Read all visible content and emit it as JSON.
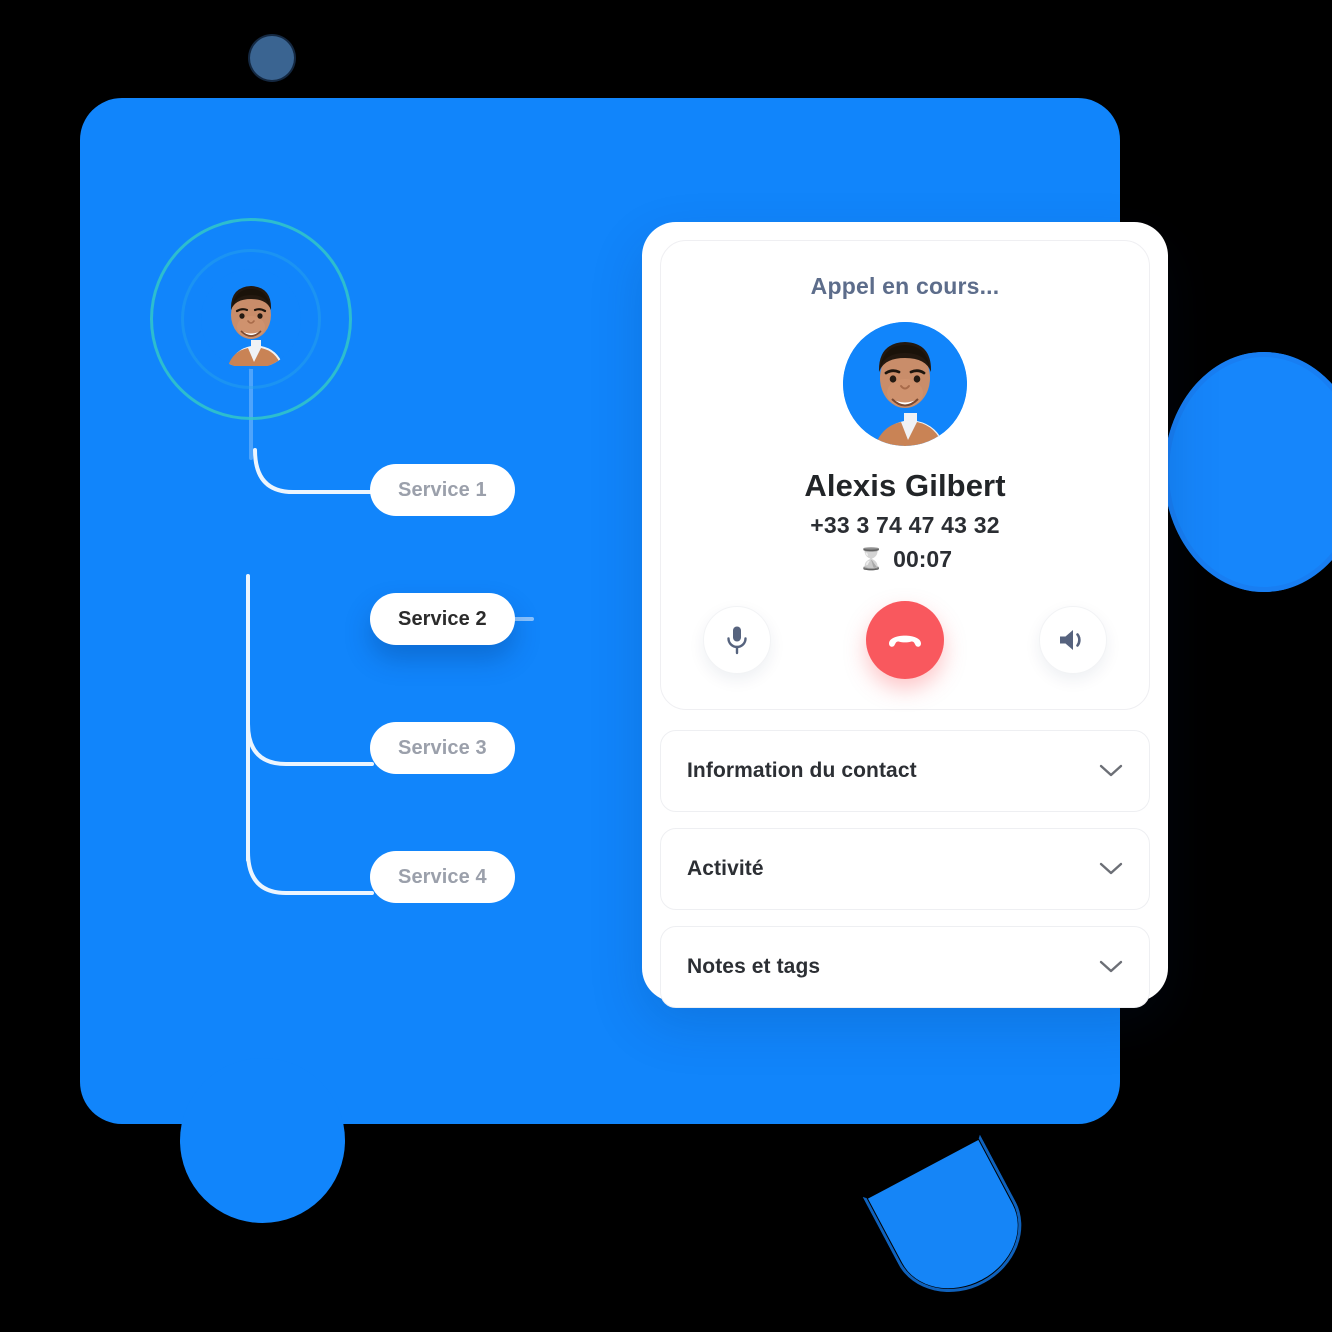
{
  "theme": {
    "brand_blue": "#1185FB",
    "panel_blue": "#1185FB",
    "pulse_ring_teal": "#33C9C4",
    "pulse_ring_blue": "#27A4E8",
    "hangup_red": "#F9585E",
    "pill_text_inactive": "#9BA0AB",
    "pill_text_active": "#2b2b2b",
    "status_text": "#5D6D8B",
    "control_icon": "#56637E"
  },
  "tree": {
    "agent": {
      "avatar_name": "agent-avatar",
      "status": "ringing"
    },
    "services": [
      {
        "label": "Service 1",
        "active": false
      },
      {
        "label": "Service 2",
        "active": true
      },
      {
        "label": "Service 3",
        "active": false
      },
      {
        "label": "Service 4",
        "active": false
      }
    ]
  },
  "call_card": {
    "status": "Appel en cours...",
    "caller": {
      "name": "Alexis Gilbert",
      "phone": "+33 3 74 47 43 32"
    },
    "timer": {
      "icon": "hourglass-icon",
      "value": "00:07"
    },
    "controls": [
      {
        "name": "mute-button",
        "icon": "microphone-icon"
      },
      {
        "name": "hangup-button",
        "icon": "phone-down-icon"
      },
      {
        "name": "speaker-button",
        "icon": "speaker-icon"
      }
    ]
  },
  "accordion": {
    "sections": [
      {
        "label": "Information du contact",
        "icon": "chevron-down-icon",
        "expanded": false
      },
      {
        "label": "Activité",
        "icon": "chevron-down-icon",
        "expanded": false
      },
      {
        "label": "Notes et tags",
        "icon": "chevron-down-icon",
        "expanded": false
      }
    ]
  },
  "decorations": [
    {
      "name": "dot-top",
      "shape": "textured-dot",
      "color": "#3f6d9e"
    },
    {
      "name": "circle-right",
      "shape": "circle",
      "color": "#1686fb"
    },
    {
      "name": "circle-bottom-left",
      "shape": "circle",
      "color": "#1185fb"
    },
    {
      "name": "crescent-bottom-right",
      "shape": "half-circle",
      "color": "#1585f7"
    }
  ]
}
